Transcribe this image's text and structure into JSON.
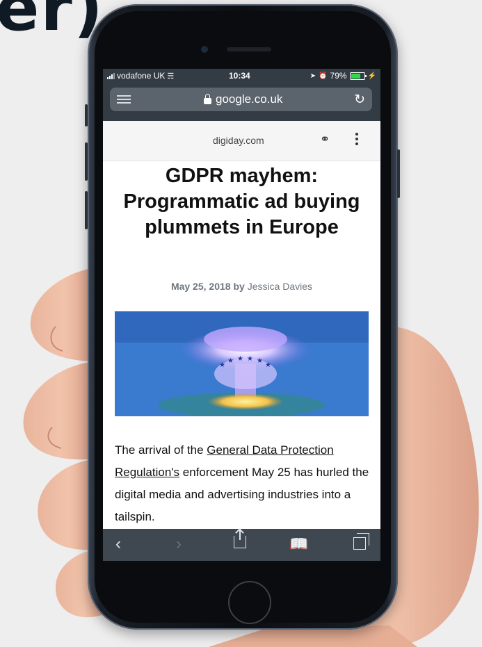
{
  "corner_text": "er)",
  "status_bar": {
    "carrier": "vodafone UK",
    "time": "10:34",
    "battery_percent": "79%",
    "battery_level": 0.79
  },
  "browser": {
    "url": "google.co.uk"
  },
  "amp_header": {
    "domain": "digiday.com"
  },
  "article": {
    "headline": "GDPR mayhem: Programmatic ad buying plummets in Europe",
    "date": "May 25, 2018",
    "by": "by",
    "author": "Jessica Davies",
    "body_start": "The arrival of the ",
    "body_link": "General Data Protection Regulation's",
    "body_rest": " enforcement May 25 has hurled the digital media and advertising industries into a tailspin."
  },
  "toolbar": {
    "back_icon": "chevron-left",
    "forward_icon": "chevron-right",
    "share_icon": "share",
    "bookmarks_icon": "book",
    "tabs_icon": "tabs"
  },
  "colors": {
    "chrome_dark": "#333c45",
    "url_field": "#5b636d",
    "toolbar": "#3f4750",
    "byline": "#6d7680"
  }
}
